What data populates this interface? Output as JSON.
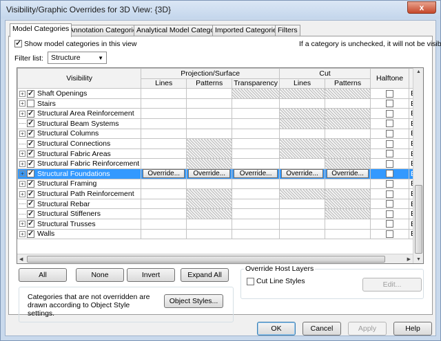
{
  "window": {
    "title": "Visibility/Graphic Overrides for 3D View: {3D}",
    "close_glyph": "x"
  },
  "tabs": [
    {
      "label": "Model Categories",
      "active": true
    },
    {
      "label": "Annotation Categories",
      "active": false
    },
    {
      "label": "Analytical Model Categories",
      "active": false
    },
    {
      "label": "Imported Categories",
      "active": false
    },
    {
      "label": "Filters",
      "active": false
    }
  ],
  "show_model_categories": {
    "label": "Show model categories in this view",
    "checked": true
  },
  "hint": "If a category is unchecked, it will not be visible.",
  "filter": {
    "label": "Filter list:",
    "value": "Structure"
  },
  "table": {
    "headers": {
      "visibility": "Visibility",
      "projection_surface": "Projection/Surface",
      "cut": "Cut",
      "halftone": "Halftone",
      "lines": "Lines",
      "patterns": "Patterns",
      "transparency": "Transparency",
      "cut_lines": "Lines",
      "cut_patterns": "Patterns",
      "detail_level_partial": ""
    },
    "override_label": "Override...",
    "by_label": "By",
    "rows": [
      {
        "name": "Shaft Openings",
        "expand": true,
        "checked": true,
        "hatch": [
          false,
          false,
          true,
          true,
          true
        ]
      },
      {
        "name": "Stairs",
        "expand": true,
        "checked": false,
        "hatch": [
          false,
          false,
          false,
          false,
          false
        ]
      },
      {
        "name": "Structural Area Reinforcement",
        "expand": true,
        "checked": true,
        "hatch": [
          false,
          false,
          false,
          true,
          true
        ]
      },
      {
        "name": "Structural Beam Systems",
        "expand": false,
        "checked": true,
        "hatch": [
          false,
          false,
          false,
          true,
          true
        ]
      },
      {
        "name": "Structural Columns",
        "expand": true,
        "checked": true,
        "hatch": [
          false,
          false,
          false,
          false,
          false
        ]
      },
      {
        "name": "Structural Connections",
        "expand": false,
        "checked": true,
        "hatch": [
          false,
          true,
          false,
          true,
          true
        ]
      },
      {
        "name": "Structural Fabric Areas",
        "expand": true,
        "checked": true,
        "hatch": [
          false,
          true,
          false,
          true,
          true
        ]
      },
      {
        "name": "Structural Fabric Reinforcement",
        "expand": true,
        "checked": true,
        "hatch": [
          false,
          true,
          false,
          false,
          true
        ]
      },
      {
        "name": "Structural Foundations",
        "expand": true,
        "checked": true,
        "selected": true,
        "hatch": [
          false,
          false,
          false,
          false,
          false
        ]
      },
      {
        "name": "Structural Framing",
        "expand": true,
        "checked": true,
        "hatch": [
          false,
          false,
          false,
          false,
          false
        ]
      },
      {
        "name": "Structural Path Reinforcement",
        "expand": true,
        "checked": true,
        "hatch": [
          false,
          true,
          false,
          true,
          true
        ]
      },
      {
        "name": "Structural Rebar",
        "expand": false,
        "checked": true,
        "hatch": [
          false,
          true,
          false,
          false,
          true
        ]
      },
      {
        "name": "Structural Stiffeners",
        "expand": false,
        "checked": true,
        "hatch": [
          false,
          true,
          false,
          false,
          true
        ]
      },
      {
        "name": "Structural Trusses",
        "expand": true,
        "checked": true,
        "hatch": [
          false,
          false,
          false,
          false,
          false
        ]
      },
      {
        "name": "Walls",
        "expand": true,
        "checked": true,
        "hatch": [
          false,
          false,
          false,
          false,
          false
        ]
      }
    ]
  },
  "buttons": {
    "all": "All",
    "none": "None",
    "invert": "Invert",
    "expand_all": "Expand All",
    "object_styles": "Object Styles...",
    "edit": "Edit...",
    "ok": "OK",
    "cancel": "Cancel",
    "apply": "Apply",
    "help": "Help"
  },
  "note": "Categories that are not overridden are drawn according to Object Style settings.",
  "override_host_layers": {
    "title": "Override Host Layers",
    "cut_line_styles": "Cut Line Styles",
    "checked": false
  }
}
